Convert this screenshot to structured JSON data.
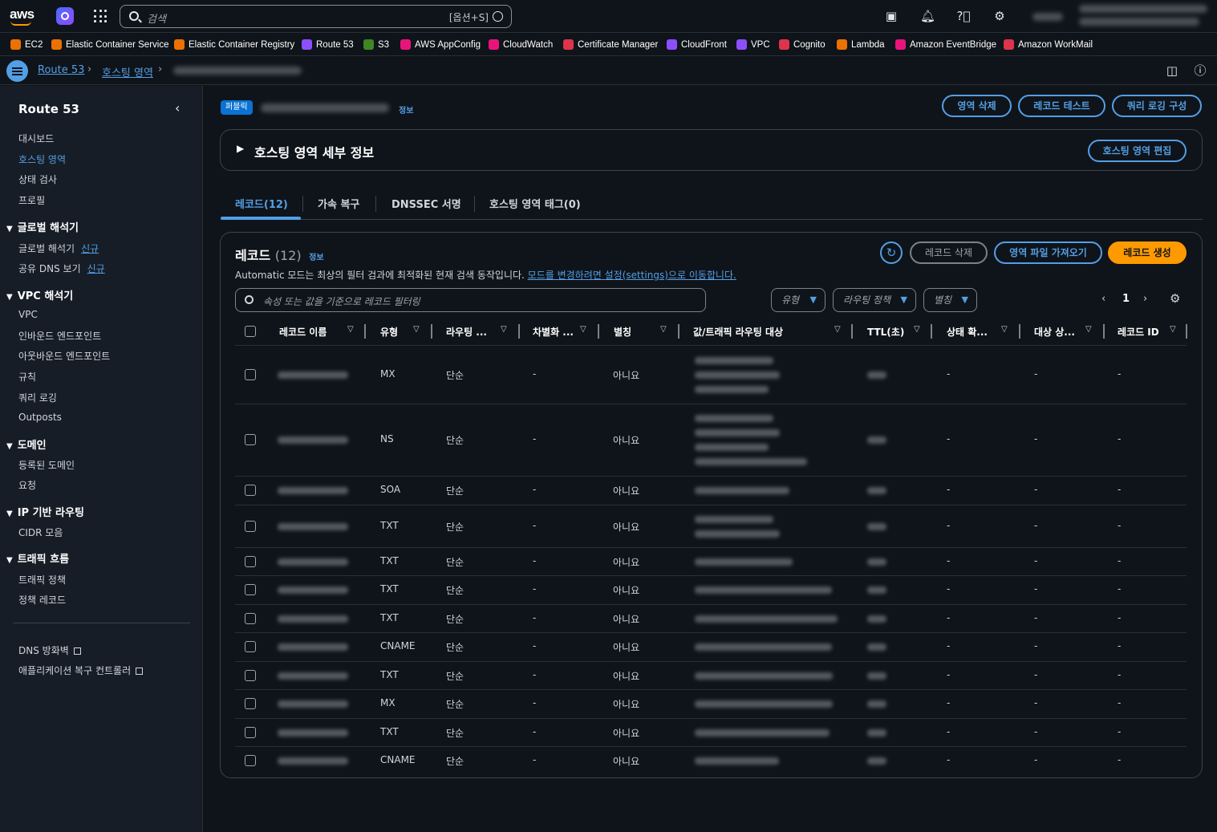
{
  "topbar": {
    "search_placeholder": "검색",
    "search_shortcut": "[옵션+S]"
  },
  "favorites": [
    {
      "label": "EC2",
      "color": "#ed7100"
    },
    {
      "label": "Elastic Container Service",
      "color": "#ed7100"
    },
    {
      "label": "Elastic Container Registry",
      "color": "#ed7100"
    },
    {
      "label": "Route 53",
      "color": "#8c4fff"
    },
    {
      "label": "S3",
      "color": "#3f8624"
    },
    {
      "label": "AWS AppConfig",
      "color": "#e7157b"
    },
    {
      "label": "CloudWatch",
      "color": "#e7157b"
    },
    {
      "label": "Certificate Manager",
      "color": "#dd344c"
    },
    {
      "label": "CloudFront",
      "color": "#8c4fff"
    },
    {
      "label": "VPC",
      "color": "#8c4fff"
    },
    {
      "label": "Cognito",
      "color": "#dd344c"
    },
    {
      "label": "Lambda",
      "color": "#ed7100"
    },
    {
      "label": "Amazon EventBridge",
      "color": "#e7157b"
    },
    {
      "label": "Amazon WorkMail",
      "color": "#dd344c"
    }
  ],
  "breadcrumb": {
    "items": [
      "Route 53",
      "호스팅 영역"
    ]
  },
  "sidebar": {
    "title": "Route 53",
    "top_items": [
      "대시보드",
      "호스팅 영역",
      "상태 검사",
      "프로필"
    ],
    "sections": [
      {
        "title": "글로벌 해석기",
        "items": [
          "글로벌 해석기",
          "공유 DNS 보기"
        ],
        "new_label": "신규"
      },
      {
        "title": "VPC 해석기",
        "items": [
          "VPC",
          "인바운드 엔드포인트",
          "아웃바운드 엔드포인트",
          "규칙",
          "쿼리 로깅",
          "Outposts"
        ]
      },
      {
        "title": "도메인",
        "items": [
          "등록된 도메인",
          "요청"
        ]
      },
      {
        "title": "IP 기반 라우팅",
        "items": [
          "CIDR 모음"
        ]
      },
      {
        "title": "트래픽 흐름",
        "items": [
          "트래픽 정책",
          "정책 레코드"
        ]
      }
    ],
    "footer_items": [
      "DNS 방화벽",
      "애플리케이션 복구 컨트롤러"
    ]
  },
  "header": {
    "badge": "퍼블릭",
    "info": "정보",
    "buttons": [
      "영역 삭제",
      "레코드 테스트",
      "쿼리 로깅 구성"
    ]
  },
  "details": {
    "title": "호스팅 영역 세부 정보",
    "edit_button": "호스팅 영역 편집"
  },
  "tabs": [
    "레코드(12)",
    "가속 복구",
    "DNSSEC 서명",
    "호스팅 영역 태그(0)"
  ],
  "records": {
    "title": "레코드",
    "count": "(12)",
    "info": "정보",
    "notice": "Automatic 모드는 최상의 필터 검과에 최적화된 현재 검색 동작입니다.",
    "notice_link": "모드를 변경하려면 설정(settings)으로 이동합니다.",
    "buttons": {
      "delete": "레코드 삭제",
      "import": "영역 파일 가져오기",
      "create": "레코드 생성"
    },
    "filter_placeholder": "속성 또는 값을 기준으로 레코드 필터링",
    "dropdowns": [
      "유형",
      "라우팅 정책",
      "별칭"
    ],
    "page": "1",
    "columns": [
      "레코드 이름",
      "유형",
      "라우팅 ...",
      "차별화 ...",
      "별칭",
      "값/트래픽 라우팅 대상",
      "TTL(초)",
      "상태 확...",
      "대상 상...",
      "레코드 ID"
    ],
    "rows": [
      {
        "type": "MX",
        "routing": "단순",
        "diff": "-",
        "alias": "아니요",
        "health": "-",
        "target": "-",
        "id": "-"
      },
      {
        "type": "NS",
        "routing": "단순",
        "diff": "-",
        "alias": "아니요",
        "health": "-",
        "target": "-",
        "id": "-"
      },
      {
        "type": "SOA",
        "routing": "단순",
        "diff": "-",
        "alias": "아니요",
        "health": "-",
        "target": "-",
        "id": "-"
      },
      {
        "type": "TXT",
        "routing": "단순",
        "diff": "-",
        "alias": "아니요",
        "health": "-",
        "target": "-",
        "id": "-"
      },
      {
        "type": "TXT",
        "routing": "단순",
        "diff": "-",
        "alias": "아니요",
        "health": "-",
        "target": "-",
        "id": "-"
      },
      {
        "type": "TXT",
        "routing": "단순",
        "diff": "-",
        "alias": "아니요",
        "health": "-",
        "target": "-",
        "id": "-"
      },
      {
        "type": "TXT",
        "routing": "단순",
        "diff": "-",
        "alias": "아니요",
        "health": "-",
        "target": "-",
        "id": "-"
      },
      {
        "type": "CNAME",
        "routing": "단순",
        "diff": "-",
        "alias": "아니요",
        "health": "-",
        "target": "-",
        "id": "-"
      },
      {
        "type": "TXT",
        "routing": "단순",
        "diff": "-",
        "alias": "아니요",
        "health": "-",
        "target": "-",
        "id": "-"
      },
      {
        "type": "MX",
        "routing": "단순",
        "diff": "-",
        "alias": "아니요",
        "health": "-",
        "target": "-",
        "id": "-"
      },
      {
        "type": "TXT",
        "routing": "단순",
        "diff": "-",
        "alias": "아니요",
        "health": "-",
        "target": "-",
        "id": "-"
      },
      {
        "type": "CNAME",
        "routing": "단순",
        "diff": "-",
        "alias": "아니요",
        "health": "-",
        "target": "-",
        "id": "-"
      }
    ]
  }
}
